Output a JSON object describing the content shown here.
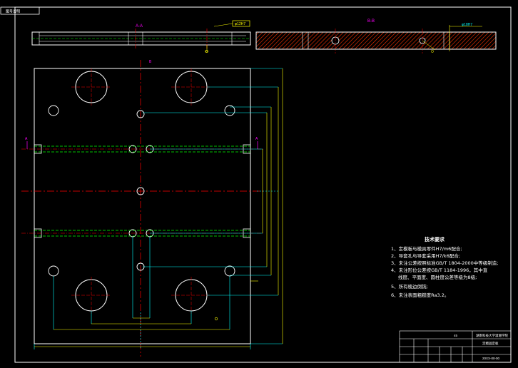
{
  "tab_label": "图号说明",
  "section_labels": {
    "top_left": "A-A",
    "top_right": "B-B",
    "centerline_b": "B",
    "section_a_left": "A",
    "section_a_right": "A"
  },
  "dimensions": {
    "top_box": "φ12H7",
    "right_callout": "φ18H7"
  },
  "tech_requirements": {
    "title": "技术要求",
    "items": [
      "1、定模板与模具零件H7/m6配合;",
      "2、导套孔与导套采用H7/k6配合;",
      "3、未注公差按照标准GB/T 1804-2000中等级制造;",
      "4、未注形位公差按GB/T 1184-1996，其中直",
      "线度、平面度、圆柱度公差等级为8级;",
      "5、所有棱边倒钝;",
      "6、未注表面粗糙度Ra3.2。"
    ]
  },
  "title_block": {
    "school": "湖南科技大学潇湘学院",
    "part_name": "定模固定板",
    "drawing_no": "20XX-00-00",
    "material": "45"
  },
  "colors": {
    "background": "#000000",
    "outline": "#ffffff",
    "centerline": "#ff0000",
    "dimension": "#ffff00",
    "leader": "#00ffff",
    "hidden": "#00ff00",
    "section": "#ff5500",
    "marker": "#ff00ff"
  }
}
